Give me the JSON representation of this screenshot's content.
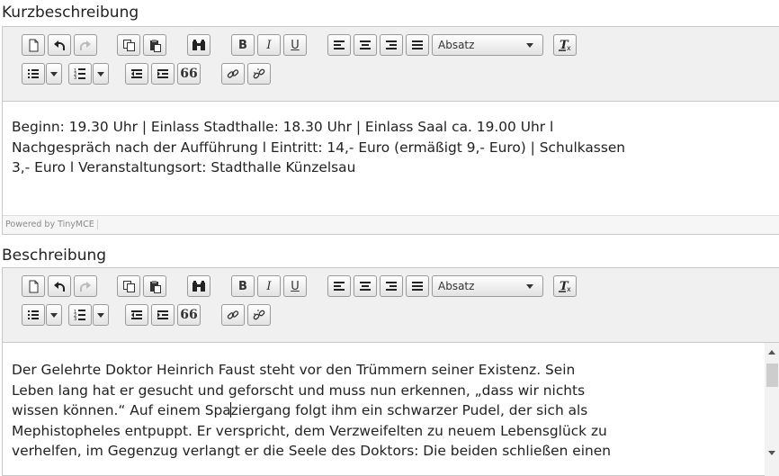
{
  "editor1": {
    "label": "Kurzbeschreibung",
    "format_select": "Absatz",
    "content_lines": [
      "Beginn: 19.30 Uhr | Einlass Stadthalle: 18.30 Uhr | Einlass Saal ca. 19.00 Uhr l",
      "Nachgespräch nach der Aufführung l Eintritt: 14,- Euro (ermäßigt 9,- Euro) | Schulkassen",
      "3,- Euro l Veranstaltungsort: Stadthalle Künzelsau"
    ],
    "powered_by": "Powered by TinyMCE"
  },
  "editor2": {
    "label": "Beschreibung",
    "format_select": "Absatz",
    "content_lines": [
      "Der Gelehrte Doktor Heinrich Faust steht vor den Trümmern seiner Existenz. Sein",
      "Leben lang hat er gesucht und geforscht und muss nun erkennen, „dass wir nichts",
      "Mephistopheles entpuppt. Er verspricht, dem Verzweifelten zu neuem Lebensglück zu",
      "verhelfen, im Gegenzug verlangt er die Seele des Doktors: Die beiden schließen einen"
    ],
    "line3_before_cursor": "wissen können.“ Auf einem Spa",
    "line3_after_cursor": "ziergang folgt ihm ein schwarzer Pudel, der sich als"
  },
  "toolbar": {
    "bold": "B",
    "italic": "I",
    "underline": "U",
    "blockquote": "66"
  },
  "icons": [
    "new-document-icon",
    "undo-icon",
    "redo-icon",
    "copy-icon",
    "paste-icon",
    "find-icon",
    "bold-icon",
    "italic-icon",
    "underline-icon",
    "align-left-icon",
    "align-center-icon",
    "align-right-icon",
    "justify-icon",
    "remove-format-icon",
    "bullet-list-icon",
    "numbered-list-icon",
    "outdent-icon",
    "indent-icon",
    "blockquote-icon",
    "link-icon",
    "unlink-icon"
  ]
}
